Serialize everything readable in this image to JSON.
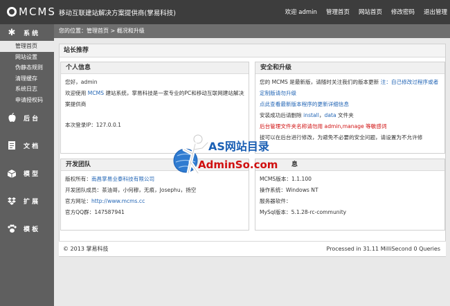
{
  "header": {
    "logo": "MCMS",
    "app_title": "移动互联建站解决方案提供商(掌易科技)",
    "nav": [
      "欢迎 admin",
      "管理首页",
      "网站首页",
      "修改密码",
      "退出管理"
    ]
  },
  "sidebar": {
    "sections": [
      {
        "label": "系 统",
        "icon": "gear-icon",
        "items": [
          "管理首页",
          "网站设置",
          "伪静态规则",
          "清理缓存",
          "系统日志",
          "申请授权码"
        ]
      },
      {
        "label": "后 台",
        "icon": "apple-icon"
      },
      {
        "label": "文 档",
        "icon": "document-icon"
      },
      {
        "label": "模 型",
        "icon": "box-icon"
      },
      {
        "label": "扩 展",
        "icon": "dropbox-icon"
      },
      {
        "label": "模 板",
        "icon": "paw-icon"
      }
    ],
    "active_item": "管理首页"
  },
  "breadcrumb": "您的位置：管理首页 > 概况和升级",
  "main": {
    "title": "站长推荐",
    "personal": {
      "title": "个人信息",
      "greeting": "您好，admin",
      "welcome_prefix": "欢迎使用",
      "welcome_link": "MCMS",
      "welcome_suffix": "建站系统，掌易科技是一家专业的PC和移动互联网建站解决方",
      "welcome_cont": "案提供商",
      "login_ip": "本次登录IP：127.0.0.1"
    },
    "upgrade": {
      "title": "安全和升级",
      "line1_prefix": "您的 MCMS 是最新版，请随时关注我们的版本更新",
      "line1_note": "注：自己修改过程序或者",
      "line2": "定制版请勿升级",
      "line3": "点此查看最新版本程序的更新详细信息",
      "line4_prefix": "安装成功后请删除",
      "line4_install": "install",
      "line4_sep": "，",
      "line4_data": "data",
      "line4_suffix": "文件夹",
      "line5": "后台管理文件夹名称请勿用 admin,manage 等敏感词",
      "line6": "拔可以在后台进行修改，为避免不必要的安全问题，请设置为不允许修"
    },
    "team": {
      "title": "开发团队",
      "copyright_label": "版权所有：",
      "copyright_value": "南昌掌易业泰科技有限公司",
      "members": "开发团队成员：茶油哥，小何穆，无痕，Josephu，扬空",
      "site_label": "官方网址：",
      "site_value": "http://www.mcms.cc",
      "qq": "官方QQ群：147587941"
    },
    "sysinfo": {
      "title": "息",
      "version": "MCMS版本：1.1.100",
      "os": "操作系统：Windows NT",
      "server": "服务器软件：",
      "mysql": "MySql版本：5.1.28-rc-community"
    }
  },
  "footer": {
    "left": "© 2013   掌易科技",
    "right": "Processed in 31.11 MilliSecond 0 Queries"
  },
  "watermark": {
    "line1": "AS网站目录",
    "line2": "AdminSo.com"
  }
}
